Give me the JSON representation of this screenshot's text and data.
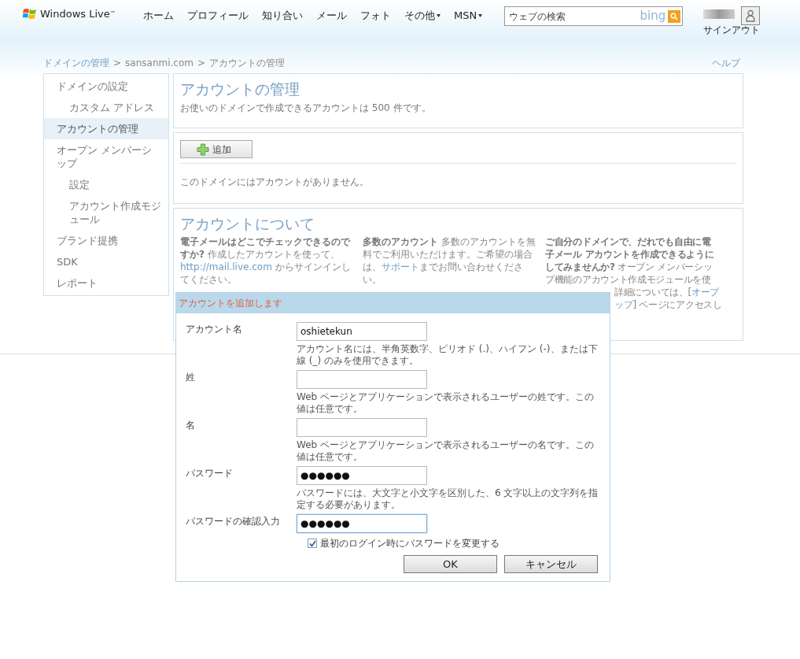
{
  "header": {
    "brand": "Windows Live",
    "brand_mark": "™",
    "nav": [
      {
        "label": "ホーム",
        "dropdown": false
      },
      {
        "label": "プロフィール",
        "dropdown": false
      },
      {
        "label": "知り合い",
        "dropdown": false
      },
      {
        "label": "メール",
        "dropdown": false
      },
      {
        "label": "フォト",
        "dropdown": false
      },
      {
        "label": "その他",
        "dropdown": true
      },
      {
        "label": "MSN",
        "dropdown": true
      }
    ],
    "search": {
      "placeholder": "ウェブの検索",
      "engine": "bing"
    },
    "sign_out": "サインアウト"
  },
  "breadcrumb": [
    "ドメインの管理",
    "sansanmi.com",
    "アカウントの管理"
  ],
  "separator": ">",
  "help": "ヘルプ",
  "sidebar": {
    "items": [
      {
        "label": "ドメインの設定",
        "selected": false,
        "children": [
          {
            "label": "カスタム アドレス",
            "selected": false
          }
        ]
      },
      {
        "label": "アカウントの管理",
        "selected": true
      },
      {
        "label": "オープン メンバーシップ",
        "selected": false,
        "children": [
          {
            "label": "設定",
            "selected": false
          },
          {
            "label": "アカウント作成モジュール",
            "selected": false
          }
        ]
      },
      {
        "label": "ブランド提携",
        "selected": false
      },
      {
        "label": "SDK",
        "selected": false
      },
      {
        "label": "レポート",
        "selected": false
      }
    ]
  },
  "main": {
    "title": "アカウントの管理",
    "subtitle": "お使いのドメインで作成できるアカウントは 500 件です。",
    "add_button": "追加",
    "empty_message": "このドメインにはアカウントがありません。",
    "about": {
      "title": "アカウントについて",
      "columns": [
        {
          "lead": "電子メールはどこでチェックできるのですか?",
          "before": "作成したアカウントを使って、",
          "link": "http://mail.live.com",
          "after": " からサインインしてください。"
        },
        {
          "lead": "多数のアカウント",
          "before": "多数のアカウントを無料でご利用いただけます。ご希望の場合は、",
          "link": "サポート",
          "after": "までお問い合わせください。"
        },
        {
          "lines": [
            "**ご自分のドメインで、だれでも自由に電**",
            "**子メール アカウントを作成できるように**",
            "**してみませんか?** オープン メンバーシッ",
            "プ機能のアカウント作成モジュールを使"
          ],
          "tail": [
            {
              "before": "詳細については、[",
              "link": "オープ"
            },
            {
              "link": "ップ",
              "after": "] ページにアクセスし"
            }
          ]
        }
      ]
    }
  },
  "dialog": {
    "title": "アカウントを追加します",
    "fields": [
      {
        "label": "アカウント名",
        "value": "oshietekun",
        "focused": false,
        "hint": "アカウント名には、半角英数字、ピリオド (.)、ハイフン (-)、または下線 (_) のみを使用できます。"
      },
      {
        "label": "姓",
        "focused": false,
        "hint": "Web ページとアプリケーションで表示されるユーザーの姓です。この値は任意です。"
      },
      {
        "label": "名",
        "focused": false,
        "hint": "Web ページとアプリケーションで表示されるユーザーの名です。この値は任意です。"
      },
      {
        "label": "パスワード",
        "value": "●●●●●●",
        "focused": false,
        "hint": "パスワードには、大文字と小文字を区別した、6 文字以上の文字列を指定する必要があります。"
      },
      {
        "label": "パスワードの確認入力",
        "value": "●●●●●●",
        "focused": true
      }
    ],
    "checkbox": {
      "label": "最初のログイン時にパスワードを変更する",
      "checked": true
    },
    "buttons": [
      "OK",
      "キャンセル"
    ]
  }
}
